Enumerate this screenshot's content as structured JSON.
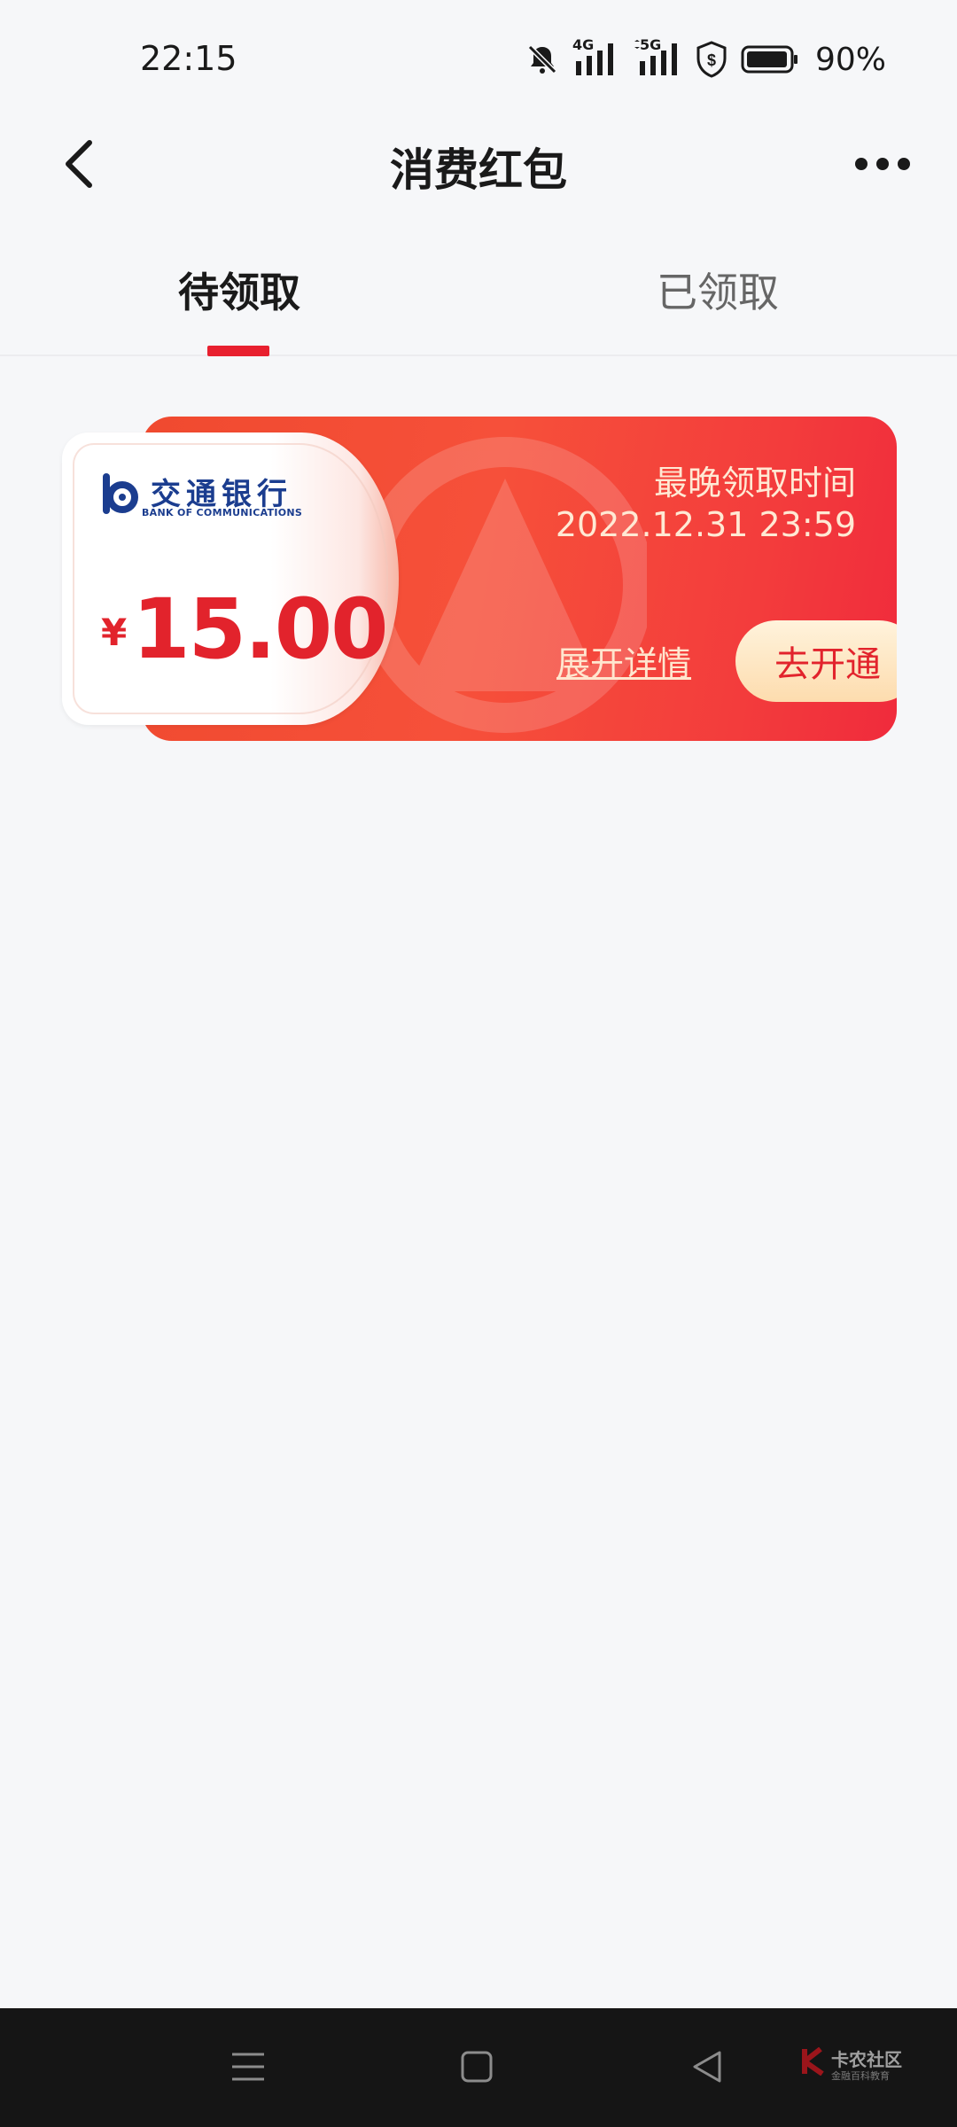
{
  "status_bar": {
    "time": "22:15",
    "net_4g": "4G",
    "net_5g": "5G",
    "battery": "90%",
    "icons": [
      "bell-off-icon",
      "signal-4g-icon",
      "signal-5g-icon",
      "shield-dollar-icon",
      "battery-icon"
    ]
  },
  "header": {
    "title": "消费红包",
    "back_icon": "chevron-left-icon",
    "more_icon": "more-dots-icon"
  },
  "tabs": [
    {
      "label": "待领取",
      "active": true
    },
    {
      "label": "已领取",
      "active": false
    }
  ],
  "coupon": {
    "bank_name_cn": "交通银行",
    "bank_name_en": "BANK OF COMMUNICATIONS",
    "currency": "¥",
    "amount": "15.00",
    "deadline_label": "最晚领取时间",
    "deadline": "2022.12.31 23:59",
    "details_link": "展开详情",
    "action_button": "去开通"
  },
  "nav_bar": {
    "icons": [
      "menu-icon",
      "home-square-icon",
      "back-triangle-icon"
    ],
    "watermark": "卡农社区",
    "watermark_sub": "金融百科教育"
  },
  "colors": {
    "accent": "#e8202f",
    "coupon_red": "#f6503a",
    "amount_red": "#e2232c",
    "bank_blue": "#1b3d8f"
  }
}
